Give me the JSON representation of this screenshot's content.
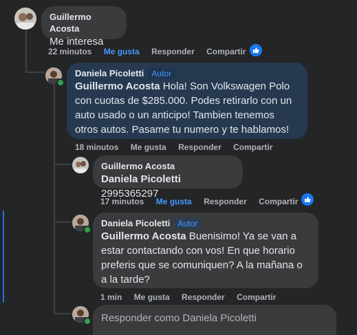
{
  "colors": {
    "background": "#242526",
    "bubble": "#3a3b3c",
    "highlight_bubble": "#263951",
    "accent": "#4599ff",
    "like_blue": "#1877f2",
    "online": "#31a24c"
  },
  "comments": [
    {
      "author": "Guillermo Acosta",
      "text": "Me interesa",
      "time": "22 minutos",
      "like": "Me gusta",
      "reply": "Responder",
      "share": "Compartir",
      "liked": true,
      "reaction_icon": "thumbs-up-icon"
    },
    {
      "author": "Daniela Picoletti",
      "badge": "Autor",
      "mention": "Guillermo Acosta",
      "text": " Hola! Son Volkswagen Polo con cuotas de $285.000. Podes retirarlo con un auto usado o un anticipo! Tambien tenemos otros autos. Pasame tu numero y te hablamos!",
      "time": "18 minutos",
      "like": "Me gusta",
      "reply": "Responder",
      "share": "Compartir",
      "liked": false
    },
    {
      "author": "Guillermo Acosta",
      "mention": "Daniela Picoletti",
      "text": " 2995365297",
      "time": "17 minutos",
      "like": "Me gusta",
      "reply": "Responder",
      "share": "Compartir",
      "liked": true,
      "reaction_icon": "thumbs-up-icon"
    },
    {
      "author": "Daniela Picoletti",
      "badge": "Autor",
      "mention": "Guillermo Acosta",
      "text": " Buenisimo! Ya se van a estar contactando con vos! En que horario preferis que se comuniquen? A la mañana o a la tarde?",
      "time": "1 min",
      "like": "Me gusta",
      "reply": "Responder",
      "share": "Compartir",
      "liked": false
    }
  ],
  "reply_box": {
    "placeholder": "Responder como Daniela Picoletti"
  }
}
